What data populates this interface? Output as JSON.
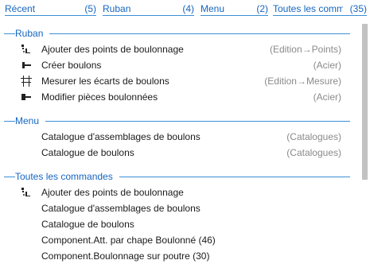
{
  "tabs": [
    {
      "label": "Récent",
      "count": "(5)"
    },
    {
      "label": "Ruban",
      "count": "(4)"
    },
    {
      "label": "Menu",
      "count": "(2)"
    },
    {
      "label": "Toutes les comm...",
      "count": "(35)"
    }
  ],
  "sections": {
    "ruban": {
      "title": "Ruban",
      "items": [
        {
          "name": "Ajouter des points de boulonnage",
          "category": "(Edition→Points)",
          "icon": "bolt-points-icon"
        },
        {
          "name": "Créer boulons",
          "category": "(Acier)",
          "icon": "bolt-icon"
        },
        {
          "name": "Mesurer les écarts de boulons",
          "category": "(Edition→Mesure)",
          "icon": "bolt-measure-icon"
        },
        {
          "name": "Modifier pièces boulonnées",
          "category": "(Acier)",
          "icon": "bolted-parts-icon"
        }
      ]
    },
    "menu": {
      "title": "Menu",
      "items": [
        {
          "name": "Catalogue d'assemblages de boulons",
          "category": "(Catalogues)"
        },
        {
          "name": "Catalogue de boulons",
          "category": "(Catalogues)"
        }
      ]
    },
    "toutes": {
      "title": "Toutes les commandes",
      "items": [
        {
          "name": "Ajouter des points de boulonnage",
          "icon": "bolt-points-icon"
        },
        {
          "name": "Catalogue d'assemblages de boulons"
        },
        {
          "name": "Catalogue de boulons"
        },
        {
          "name": "Component.Att. par chape Boulonné (46)"
        },
        {
          "name": "Component.Boulonnage sur poutre (30)"
        }
      ]
    }
  },
  "colors": {
    "accent": "#1565c0",
    "line": "#3a8fd6",
    "muted": "#8a8a8a"
  }
}
